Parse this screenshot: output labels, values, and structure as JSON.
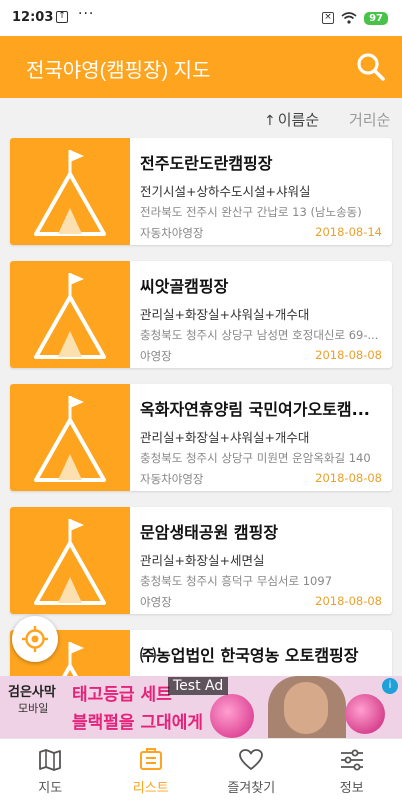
{
  "status_bar": {
    "time": "12:03",
    "dots": "···",
    "battery": "97"
  },
  "app_bar": {
    "title": "전국야영(캠핑장) 지도",
    "color": "#fea41f"
  },
  "sort": {
    "by_name": "이름순",
    "by_distance": "거리순"
  },
  "campsites": [
    {
      "name": "전주도란도란캠핑장",
      "facilities": "전기시설+상하수도시설+샤워실",
      "address": "전라북도 전주시 완산구 간납로 13 (남노송동)",
      "type": "자동차야영장",
      "date": "2018-08-14"
    },
    {
      "name": "씨앗골캠핑장",
      "facilities": "관리실+화장실+샤워실+개수대",
      "address": "충청북도 청주시 상당구 남성면 호정대신로 69-...",
      "type": "야영장",
      "date": "2018-08-08"
    },
    {
      "name": "옥화자연휴양림 국민여가오토캠...",
      "facilities": "관리실+화장실+샤워실+개수대",
      "address": "충청북도 청주시 상당구 미원면 운암옥화길 140",
      "type": "자동차야영장",
      "date": "2018-08-08"
    },
    {
      "name": "문암생태공원 캠핑장",
      "facilities": "관리실+화장실+세면실",
      "address": "충청북도 청주시 흥덕구 무심서로 1097",
      "type": "야영장",
      "date": "2018-08-08"
    },
    {
      "name": "㈜농업법인 한국영농 오토캠핑장",
      "facilities": "",
      "address": "",
      "type": "",
      "date": ""
    }
  ],
  "ad": {
    "label": "Test Ad",
    "brand": "검은사막",
    "brand_sub": "모바일",
    "headline1": "태고등급 세트",
    "headline2": "블랙펄을 그대에게",
    "choice_icon": "i"
  },
  "bottom_nav": [
    {
      "label": "지도",
      "icon": "map-icon"
    },
    {
      "label": "리스트",
      "icon": "list-icon"
    },
    {
      "label": "즐겨찾기",
      "icon": "heart-icon"
    },
    {
      "label": "정보",
      "icon": "sliders-icon"
    }
  ]
}
